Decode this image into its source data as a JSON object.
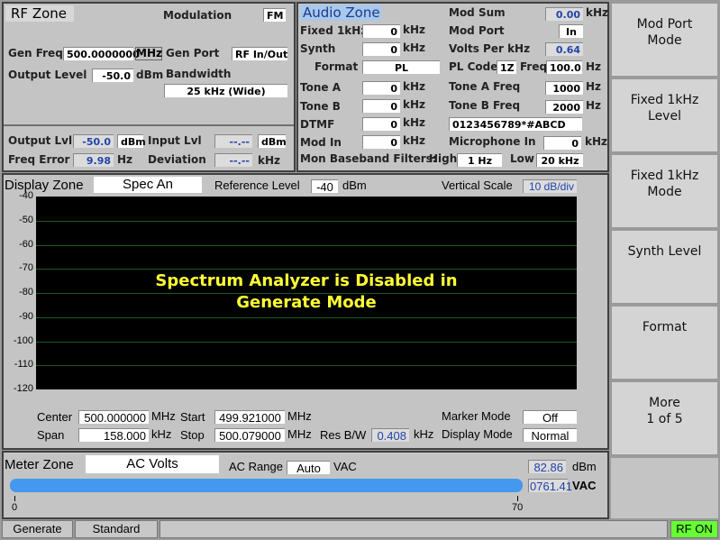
{
  "rf_zone": {
    "title": "RF Zone",
    "modulation_label": "Modulation",
    "modulation": "FM",
    "gen_freq_label": "Gen Freq",
    "gen_freq": "500.0000000",
    "gen_freq_unit": "MHz",
    "gen_port_label": "Gen Port",
    "gen_port": "RF In/Out",
    "output_level_label": "Output Level",
    "output_level": "-50.0",
    "output_level_unit": "dBm",
    "bandwidth_label": "Bandwidth",
    "bandwidth": "25 kHz (Wide)",
    "output_lvl_label": "Output Lvl",
    "output_lvl": "-50.0",
    "output_lvl_unit": "dBm",
    "input_lvl_label": "Input Lvl",
    "input_lvl": "--.--",
    "input_lvl_unit": "dBm",
    "freq_error_label": "Freq Error",
    "freq_error": "9.98",
    "freq_error_unit": "Hz",
    "deviation_label": "Deviation",
    "deviation": "--.--",
    "deviation_unit": "kHz"
  },
  "audio_zone": {
    "title": "Audio Zone",
    "mod_sum_label": "Mod Sum",
    "mod_sum": "0.00",
    "mod_sum_unit": "kHz",
    "fixed_label": "Fixed 1kHz",
    "fixed": "0",
    "fixed_unit": "kHz",
    "mod_port_label": "Mod Port",
    "mod_port": "In",
    "synth_label": "Synth",
    "synth": "0",
    "synth_unit": "kHz",
    "volts_label": "Volts Per kHz",
    "volts": "0.64",
    "format_label": "Format",
    "format": "PL",
    "pl_code_label": "PL Code",
    "pl_code": "1Z",
    "pl_freq_label": "Freq",
    "pl_freq": "100.0",
    "pl_freq_unit": "Hz",
    "tone_a_label": "Tone A",
    "tone_a": "0",
    "tone_a_unit": "kHz",
    "tone_a_freq_label": "Tone A Freq",
    "tone_a_freq": "1000",
    "tone_a_freq_unit": "Hz",
    "tone_b_label": "Tone B",
    "tone_b": "0",
    "tone_b_unit": "kHz",
    "tone_b_freq_label": "Tone B Freq",
    "tone_b_freq": "2000",
    "tone_b_freq_unit": "Hz",
    "dtmf_label": "DTMF",
    "dtmf": "0",
    "dtmf_unit": "kHz",
    "dtmf_string": "0123456789*#ABCD",
    "mod_in_label": "Mod In",
    "mod_in": "0",
    "mod_in_unit": "kHz",
    "mic_label": "Microphone In",
    "mic": "0",
    "mic_unit": "kHz",
    "filters_label": "Mon Baseband Filters:",
    "high_label": "High",
    "high": "1 Hz",
    "low_label": "Low",
    "low": "20 kHz"
  },
  "display_zone": {
    "title": "Display Zone",
    "mode": "Spec An",
    "ref_level_label": "Reference Level",
    "ref_level": "-40",
    "ref_level_unit": "dBm",
    "vscale_label": "Vertical Scale",
    "vscale": "10 dB/div",
    "y_ticks": [
      "-40",
      "-50",
      "-60",
      "-70",
      "-80",
      "-90",
      "-100",
      "-110",
      "-120"
    ],
    "message_line1": "Spectrum Analyzer is Disabled in",
    "message_line2": "Generate Mode",
    "message_color": "#ffff33",
    "center_label": "Center",
    "center": "500.000000",
    "center_unit": "MHz",
    "start_label": "Start",
    "start": "499.921000",
    "start_unit": "MHz",
    "span_label": "Span",
    "span": "158.000",
    "span_unit": "kHz",
    "stop_label": "Stop",
    "stop": "500.079000",
    "stop_unit": "MHz",
    "resbw_label": "Res B/W",
    "resbw": "0.408",
    "resbw_unit": "kHz",
    "marker_mode_label": "Marker Mode",
    "marker_mode": "Off",
    "display_mode_label": "Display Mode",
    "display_mode": "Normal"
  },
  "meter_zone": {
    "title": "Meter Zone",
    "mode": "AC Volts",
    "ac_range_label": "AC Range",
    "ac_range": "Auto",
    "ac_range_unit": "VAC",
    "dbm": "82.86",
    "dbm_unit": "dBm",
    "vac": "0761.41",
    "vac_unit": "VAC",
    "scale_min": "0",
    "scale_max": "70",
    "bar_fill_percent": 100,
    "bar_color": "#4499ee"
  },
  "softkeys": [
    "Mod Port\nMode",
    "Fixed 1kHz\nLevel",
    "Fixed 1kHz\nMode",
    "Synth Level",
    "Format",
    "More\n1 of 5"
  ],
  "status": {
    "mode": "Generate",
    "standard": "Standard",
    "message": "",
    "rf": "RF ON",
    "rf_color": "#66ff33"
  }
}
